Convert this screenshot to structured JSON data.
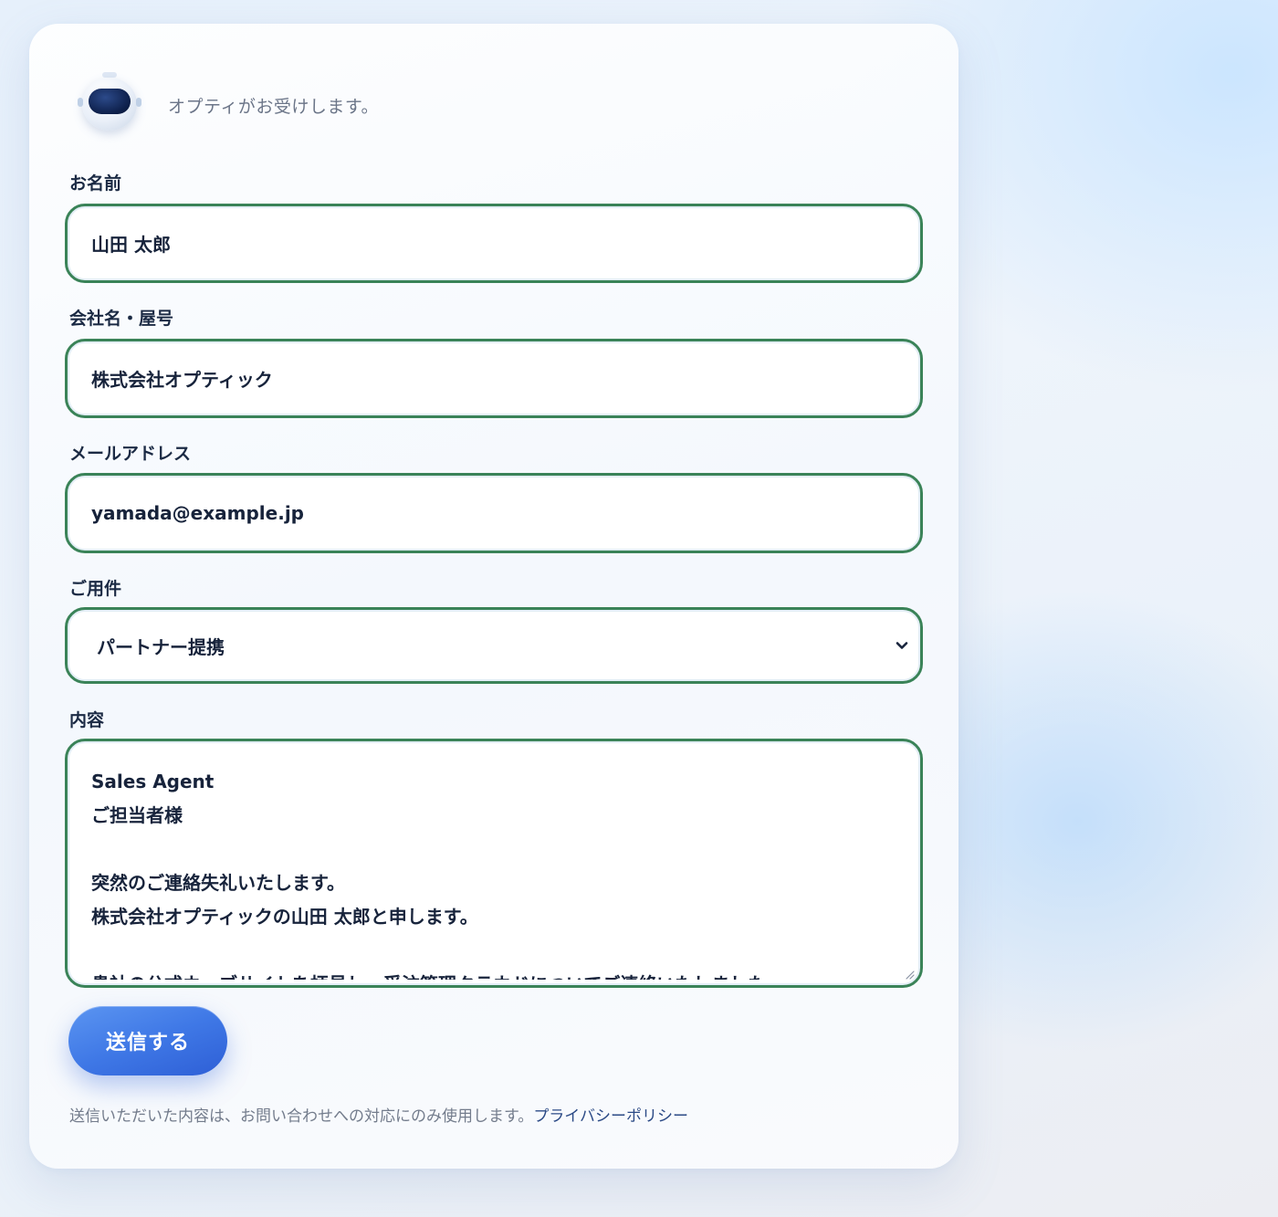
{
  "header": {
    "greeting": "オプティがお受けします。"
  },
  "form": {
    "name": {
      "label": "お名前",
      "value": "山田 太郎"
    },
    "company": {
      "label": "会社名・屋号",
      "value": "株式会社オプティック"
    },
    "email": {
      "label": "メールアドレス",
      "value": "yamada@example.jp"
    },
    "subject": {
      "label": "ご用件",
      "selected": "パートナー提携"
    },
    "content": {
      "label": "内容",
      "lines": [
        "Sales Agent",
        "ご担当者様",
        "",
        "突然のご連絡失礼いたします。",
        "株式会社オプティックの山田 太郎と申します。",
        "",
        "貴社の公式ウェブサイトを拝見し、受注管理クラウドについてご連絡いたしました。"
      ]
    },
    "submit_label": "送信する",
    "footnote_text": "送信いただいた内容は、お問い合わせへの対応にのみ使用します。",
    "privacy_link": "プライバシーポリシー"
  },
  "colors": {
    "field_border": "#3a8358",
    "button": "#3f78e6",
    "text": "#17233b",
    "muted": "#737c8c",
    "link": "#2b4a86"
  },
  "icons": {
    "avatar": "robot-avatar-icon",
    "select": "chevron-down-icon",
    "resize": "resize-handle-icon"
  }
}
